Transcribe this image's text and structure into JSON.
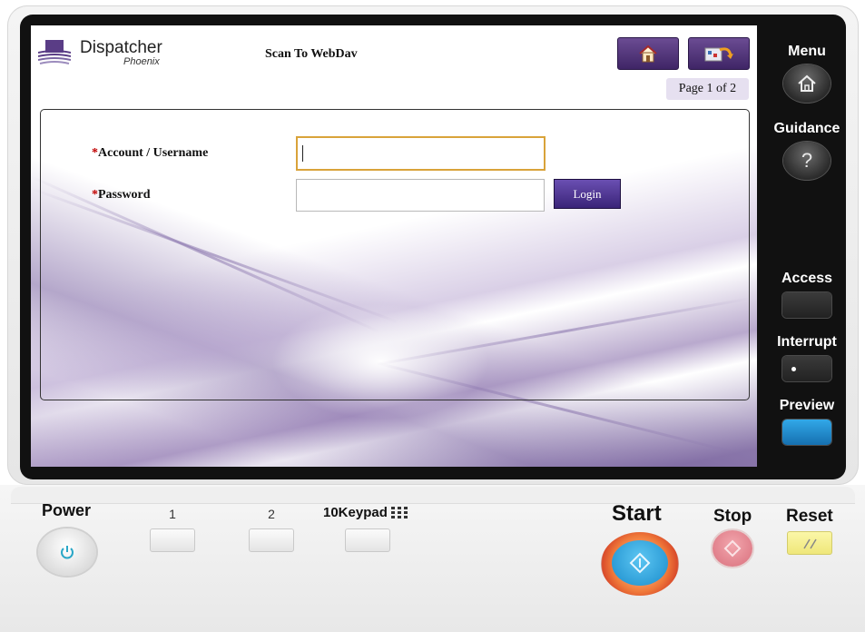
{
  "app": {
    "logo_title": "Dispatcher",
    "logo_subtitle": "Phoenix",
    "screen_title": "Scan To WebDav",
    "page_indicator": "Page 1 of 2"
  },
  "form": {
    "account_required_mark": "*",
    "account_label": "Account / Username",
    "account_value": "",
    "password_required_mark": "*",
    "password_label": "Password",
    "password_value": "",
    "login_label": "Login"
  },
  "top_buttons": [
    {
      "icon": "home-icon"
    },
    {
      "icon": "back-icon"
    }
  ],
  "side_panel": {
    "menu_label": "Menu",
    "guidance_label": "Guidance",
    "guidance_glyph": "?",
    "access_label": "Access",
    "interrupt_label": "Interrupt",
    "preview_label": "Preview"
  },
  "control_panel": {
    "power_label": "Power",
    "key1_label": "1",
    "key2_label": "2",
    "keypad_label": "10Keypad",
    "start_label": "Start",
    "stop_label": "Stop",
    "reset_label": "Reset"
  },
  "colors": {
    "accent": "#4b2f7a",
    "login_button": "#4a328f",
    "start_button": "#2a9fd8",
    "stop_button": "#d97a84",
    "preview_button": "#1e88c8",
    "reset_button": "#f3ee8c"
  }
}
